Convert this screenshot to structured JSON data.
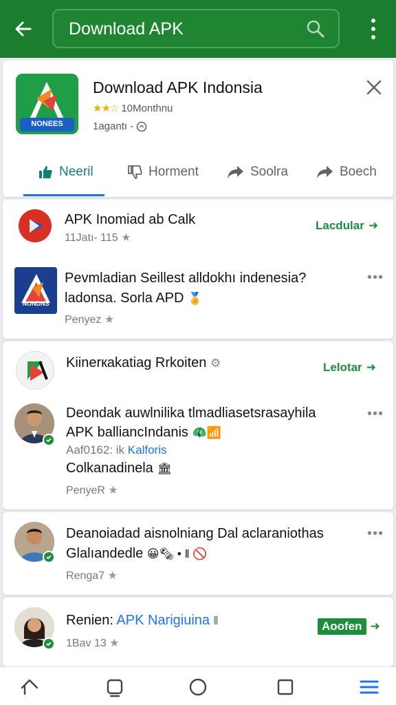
{
  "search": {
    "query": "Download APK"
  },
  "app": {
    "title": "Download APK Indonsia",
    "rating_stars": "★★☆",
    "rating_text": "10Monthnu",
    "meta": "1agantı -",
    "logo_text": "NONEES"
  },
  "tabs": [
    {
      "label": "Neeril",
      "icon": "thumbs-up-icon"
    },
    {
      "label": "Horment",
      "icon": "thumbs-down-icon"
    },
    {
      "label": "Soolra",
      "icon": "share-icon"
    },
    {
      "label": "Boech",
      "icon": "share-icon"
    }
  ],
  "posts": [
    {
      "title": "APK Inomiad ab Calk",
      "sub": "11Jatı- 115",
      "action": "Lacdular"
    },
    {
      "line1": "Pevmladian Seillest alldokhı indenesia?",
      "line2": "ladonsa. Sorla APD",
      "meta": "Penyez",
      "logo_text": "NONDNS"
    },
    {
      "title": "Kiinerкakatiag Rrkoiten",
      "action": "Lelotar"
    },
    {
      "line1": "Deondak auwlnilika tlmadliasetsrasayhila",
      "line2": "APK balliancIndanis",
      "line3a": "Aaf0162: ik",
      "line3b": "Kalforis",
      "line4": "Colkanadinela",
      "meta": "PenyeR"
    },
    {
      "line1": "Deanoiadad aisnolniang Dal aclaraniothas",
      "line2": "Glalıandedle",
      "meta": "Renga7"
    },
    {
      "title_a": "Renien: ",
      "title_b": "APK Narigiuina",
      "sub": "1Bav 13",
      "action": "Aoofen"
    }
  ],
  "colors": {
    "brand_green": "#1b7d2e",
    "accent_blue": "#1a73e8",
    "action_green": "#1e8e3e",
    "star": "#f2a900"
  }
}
